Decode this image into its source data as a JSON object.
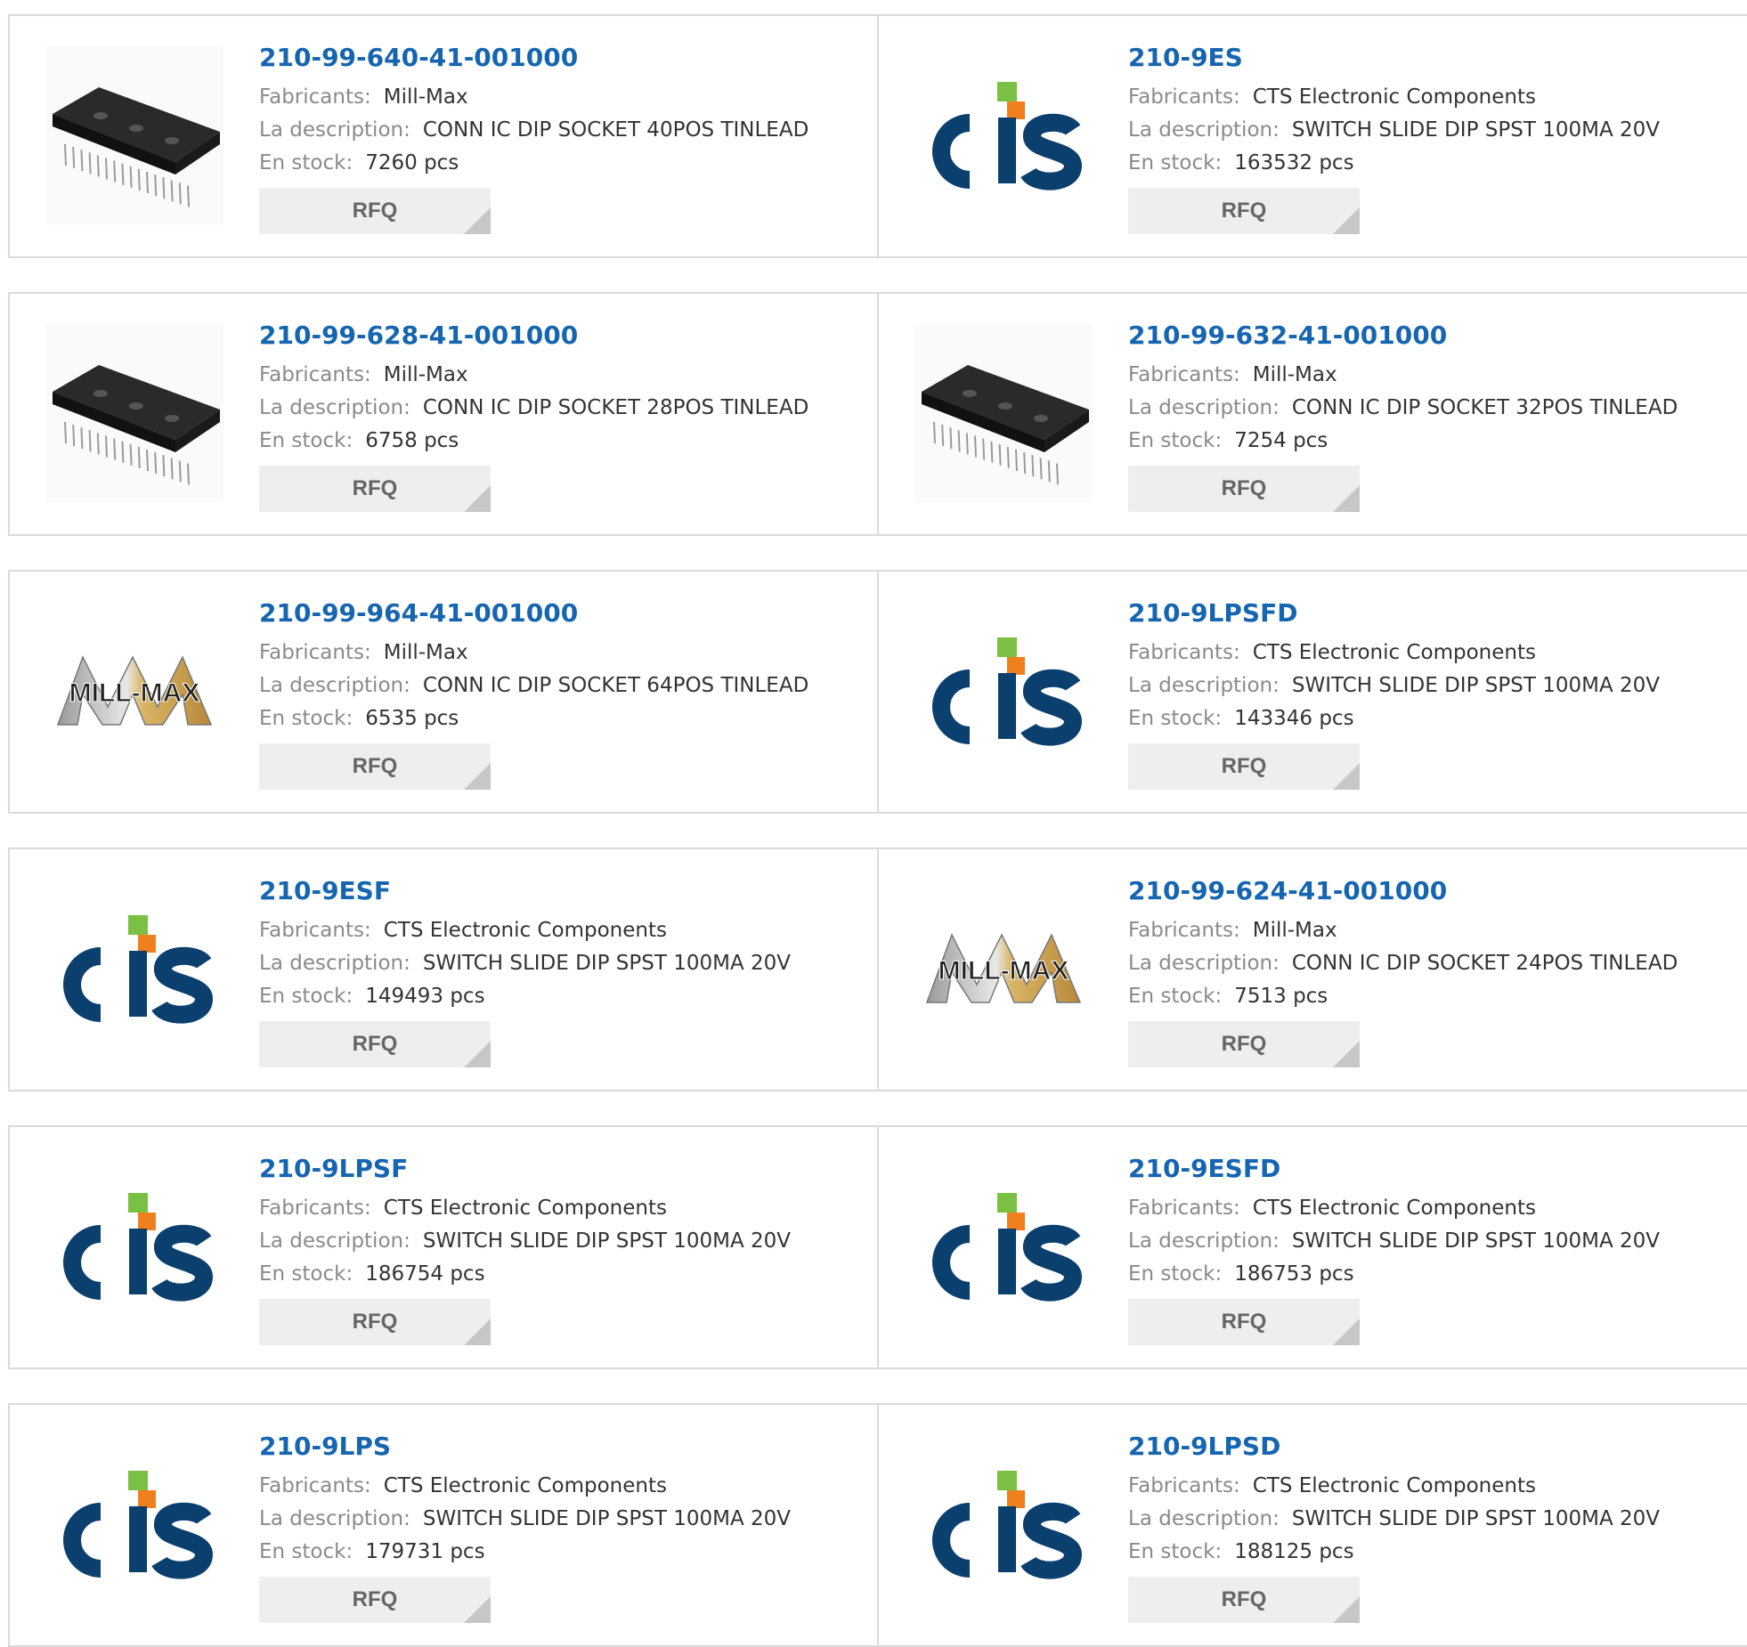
{
  "labels": {
    "manufacturer": "Fabricants:",
    "description": "La description:",
    "stock": "En stock:",
    "rfq": "RFQ"
  },
  "products": [
    {
      "part_number": "210-99-640-41-001000",
      "manufacturer": "Mill-Max",
      "description": "CONN IC DIP SOCKET 40POS TINLEAD",
      "stock": "7260 pcs",
      "image": "dip-socket-photo"
    },
    {
      "part_number": "210-9ES",
      "manufacturer": "CTS Electronic Components",
      "description": "SWITCH SLIDE DIP SPST 100MA 20V",
      "stock": "163532 pcs",
      "image": "cts-logo"
    },
    {
      "part_number": "210-99-628-41-001000",
      "manufacturer": "Mill-Max",
      "description": "CONN IC DIP SOCKET 28POS TINLEAD",
      "stock": "6758 pcs",
      "image": "dip-socket-photo"
    },
    {
      "part_number": "210-99-632-41-001000",
      "manufacturer": "Mill-Max",
      "description": "CONN IC DIP SOCKET 32POS TINLEAD",
      "stock": "7254 pcs",
      "image": "dip-socket-photo"
    },
    {
      "part_number": "210-99-964-41-001000",
      "manufacturer": "Mill-Max",
      "description": "CONN IC DIP SOCKET 64POS TINLEAD",
      "stock": "6535 pcs",
      "image": "mill-max-logo",
      "logo_text": "MILL-MAX"
    },
    {
      "part_number": "210-9LPSFD",
      "manufacturer": "CTS Electronic Components",
      "description": "SWITCH SLIDE DIP SPST 100MA 20V",
      "stock": "143346 pcs",
      "image": "cts-logo"
    },
    {
      "part_number": "210-9ESF",
      "manufacturer": "CTS Electronic Components",
      "description": "SWITCH SLIDE DIP SPST 100MA 20V",
      "stock": "149493 pcs",
      "image": "cts-logo"
    },
    {
      "part_number": "210-99-624-41-001000",
      "manufacturer": "Mill-Max",
      "description": "CONN IC DIP SOCKET 24POS TINLEAD",
      "stock": "7513 pcs",
      "image": "mill-max-logo",
      "logo_text": "MILL-MAX"
    },
    {
      "part_number": "210-9LPSF",
      "manufacturer": "CTS Electronic Components",
      "description": "SWITCH SLIDE DIP SPST 100MA 20V",
      "stock": "186754 pcs",
      "image": "cts-logo"
    },
    {
      "part_number": "210-9ESFD",
      "manufacturer": "CTS Electronic Components",
      "description": "SWITCH SLIDE DIP SPST 100MA 20V",
      "stock": "186753 pcs",
      "image": "cts-logo"
    },
    {
      "part_number": "210-9LPS",
      "manufacturer": "CTS Electronic Components",
      "description": "SWITCH SLIDE DIP SPST 100MA 20V",
      "stock": "179731 pcs",
      "image": "cts-logo"
    },
    {
      "part_number": "210-9LPSD",
      "manufacturer": "CTS Electronic Components",
      "description": "SWITCH SLIDE DIP SPST 100MA 20V",
      "stock": "188125 pcs",
      "image": "cts-logo"
    }
  ],
  "colors": {
    "link": "#1565b0",
    "label": "#8a8a8a",
    "value": "#333333",
    "border": "#dadada",
    "button_bg": "#eeeeee",
    "cts_blue": "#0b3f6e",
    "cts_green": "#7ac143",
    "cts_orange": "#f07f1e"
  }
}
